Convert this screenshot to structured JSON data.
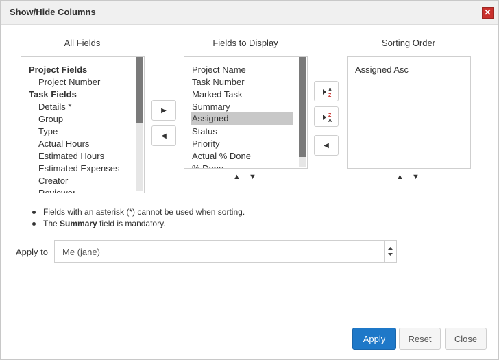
{
  "dialog": {
    "title": "Show/Hide Columns",
    "close_icon": "close-icon",
    "close_glyph": "✕"
  },
  "headers": {
    "all_fields": "All Fields",
    "fields_to_display": "Fields to Display",
    "sorting_order": "Sorting Order"
  },
  "all_fields": {
    "items": [
      {
        "label": "Project Fields",
        "group": true
      },
      {
        "label": "Project Number",
        "group": false
      },
      {
        "label": "Task Fields",
        "group": true
      },
      {
        "label": "Details *",
        "group": false
      },
      {
        "label": "Group",
        "group": false
      },
      {
        "label": "Type",
        "group": false
      },
      {
        "label": "Actual Hours",
        "group": false
      },
      {
        "label": "Estimated Hours",
        "group": false
      },
      {
        "label": "Estimated Expenses",
        "group": false
      },
      {
        "label": "Creator",
        "group": false
      },
      {
        "label": "Reviewer",
        "group": false
      }
    ]
  },
  "display_fields": {
    "items": [
      {
        "label": "Project Name",
        "selected": false
      },
      {
        "label": "Task Number",
        "selected": false
      },
      {
        "label": "Marked Task",
        "selected": false
      },
      {
        "label": "Summary",
        "selected": false
      },
      {
        "label": "Assigned",
        "selected": true
      },
      {
        "label": "Status",
        "selected": false
      },
      {
        "label": "Priority",
        "selected": false
      },
      {
        "label": "Actual % Done",
        "selected": false
      },
      {
        "label": "% Done",
        "selected": false
      }
    ],
    "move_up_glyph": "▲",
    "move_down_glyph": "▼"
  },
  "sorting": {
    "items": [
      "Assigned Asc"
    ],
    "move_up_glyph": "▲",
    "move_down_glyph": "▼"
  },
  "buttons": {
    "add_glyph": "▶",
    "remove_glyph": "◀",
    "sort_remove_glyph": "◀",
    "sort_asc_icon": "sort-ascending-icon",
    "sort_desc_icon": "sort-descending-icon",
    "sort_asc_letters": [
      "A",
      "Z"
    ],
    "sort_desc_letters": [
      "Z",
      "A"
    ],
    "sort_letter_color": "#c9302c"
  },
  "notes": {
    "line1": "Fields with an asterisk (*) cannot be used when sorting.",
    "line2_prefix": "The ",
    "line2_bold": "Summary",
    "line2_suffix": " field is mandatory."
  },
  "apply_to": {
    "label": "Apply to",
    "value": "Me (jane)"
  },
  "footer": {
    "apply": "Apply",
    "reset": "Reset",
    "close": "Close"
  },
  "colors": {
    "primary": "#1e78c8",
    "danger": "#c9302c",
    "selected_row": "#c8c8c8",
    "scroll_thumb": "#7a7a7a"
  }
}
